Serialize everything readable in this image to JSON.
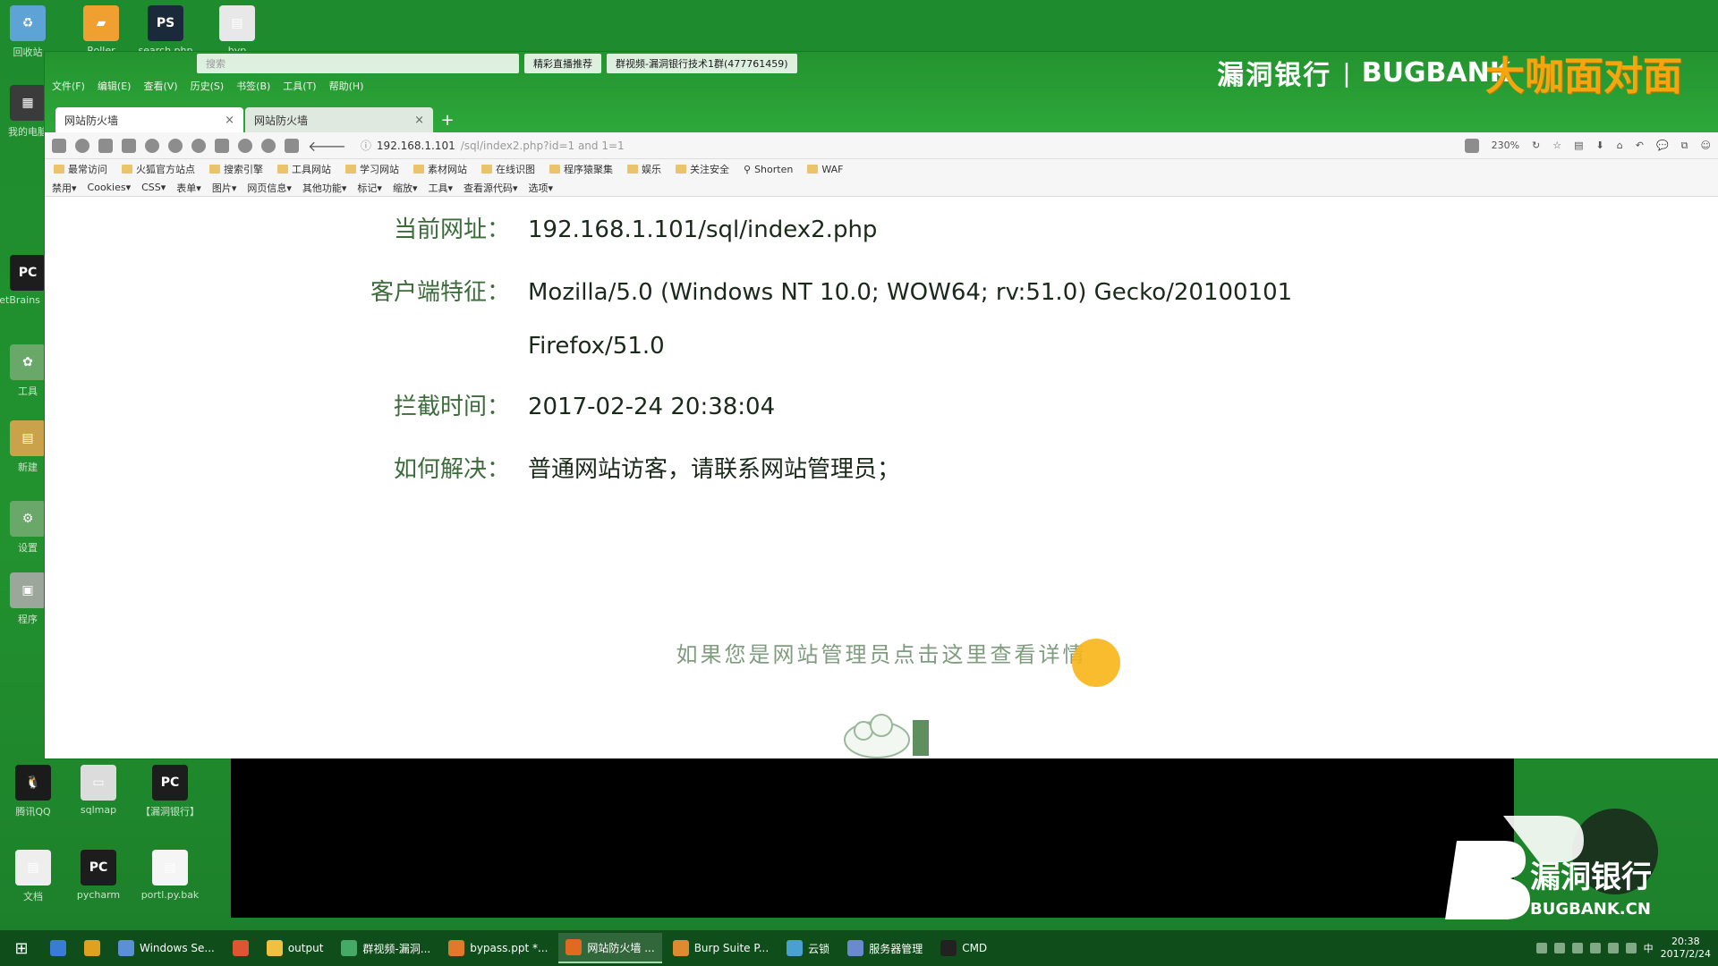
{
  "desktop": {
    "icons_left": [
      {
        "label": "回收站",
        "color": "#5ea3d6",
        "glyph": "♻"
      },
      {
        "label": "我的电脑",
        "color": "#3b3b3b",
        "glyph": "▦"
      },
      {
        "label": "JetBrains PyCharm",
        "color": "#1d1d1d",
        "glyph": "PC"
      },
      {
        "label": "工具",
        "color": "#6aa86a",
        "glyph": "✿"
      },
      {
        "label": "新建",
        "color": "#c9a24a",
        "glyph": "▤"
      },
      {
        "label": "设置",
        "color": "#6aa86a",
        "glyph": "⚙"
      },
      {
        "label": "程序",
        "color": "#9aa79a",
        "glyph": "▣"
      }
    ],
    "icons_top": [
      {
        "label": "Roller",
        "color": "#f0a030",
        "glyph": "▰"
      },
      {
        "label": "search.php",
        "color": "#1b2a3a",
        "glyph": "PS"
      },
      {
        "label": "byp",
        "color": "#e8e8e8",
        "glyph": "▤"
      }
    ],
    "icons_bottom": [
      {
        "label": "腾讯QQ",
        "color": "#1b1b1b",
        "glyph": "🐧"
      },
      {
        "label": "sqlmap",
        "color": "#dcdcdc",
        "glyph": "▭"
      },
      {
        "label": "【漏洞银行】",
        "color": "#1d1d1d",
        "glyph": "PC"
      },
      {
        "label": "文档",
        "color": "#eeeeee",
        "glyph": "▤"
      },
      {
        "label": "pycharm",
        "color": "#1d1d1d",
        "glyph": "PC"
      },
      {
        "label": "portl.py.bak",
        "color": "#f5f5f5",
        "glyph": "▤"
      }
    ]
  },
  "browser": {
    "menu": [
      "文件(F)",
      "编辑(E)",
      "查看(V)",
      "历史(S)",
      "书签(B)",
      "工具(T)",
      "帮助(H)"
    ],
    "window_tabs": [
      "搜索",
      "精彩直播推荐",
      "群视频-漏洞银行技术1群(477761459)"
    ],
    "tabs": [
      {
        "label": "网站防火墙",
        "active": true
      },
      {
        "label": "网站防火墙",
        "active": false
      }
    ],
    "new_tab": "+",
    "url_main": "192.168.1.101",
    "url_rest": "/sql/index2.php?id=1 and 1=1",
    "zoom": "230%",
    "bookmarks": [
      "最常访问",
      "火狐官方站点",
      "搜索引擎",
      "工具网站",
      "学习网站",
      "素材网站",
      "在线识图",
      "程序猿聚集",
      "娱乐",
      "关注安全",
      "Shorten",
      "WAF"
    ],
    "devtools": [
      "禁用▾",
      "Cookies▾",
      "CSS▾",
      "表单▾",
      "图片▾",
      "网页信息▾",
      "其他功能▾",
      "标记▾",
      "缩放▾",
      "工具▾",
      "查看源代码▾",
      "选项▾"
    ]
  },
  "overlay": {
    "brand_cn": "漏洞银行",
    "brand_sep": "|",
    "brand_en": "BUGBANK",
    "brand_big": "大咖面对面",
    "logo_cn": "漏洞银行",
    "logo_en": "BUGBANK.CN"
  },
  "page": {
    "rows": [
      {
        "label": "当前网址：",
        "value": "192.168.1.101/sql/index2.php"
      },
      {
        "label": "客户端特征：",
        "value": "Mozilla/5.0 (Windows NT 10.0; WOW64; rv:51.0) Gecko/20100101"
      },
      {
        "label": "",
        "value": "Firefox/51.0"
      },
      {
        "label": "拦截时间：",
        "value": "2017-02-24 20:38:04"
      },
      {
        "label": "如何解决：",
        "value": "普通网站访客，请联系网站管理员；"
      }
    ],
    "admin_link": "如果您是网站管理员点击这里查看详情"
  },
  "taskbar": {
    "items": [
      {
        "label": "",
        "color": "#3a7bd5"
      },
      {
        "label": "",
        "color": "#e0a020"
      },
      {
        "label": "Windows Se...",
        "color": "#5b8fd6"
      },
      {
        "label": "",
        "color": "#dd5533"
      },
      {
        "label": "output",
        "color": "#f0c040"
      },
      {
        "label": "群视频-漏洞...",
        "color": "#44aa66"
      },
      {
        "label": "bypass.ppt *...",
        "color": "#e07a2a"
      },
      {
        "label": "网站防火墙 ...",
        "color": "#e06a20",
        "active": true
      },
      {
        "label": "Burp Suite P...",
        "color": "#e08a30"
      },
      {
        "label": "云锁",
        "color": "#4aa0d0"
      },
      {
        "label": "服务器管理",
        "color": "#6a8ad0"
      },
      {
        "label": "CMD",
        "color": "#222222"
      }
    ],
    "time": "20:38",
    "date": "2017/2/24",
    "ime": "中"
  }
}
